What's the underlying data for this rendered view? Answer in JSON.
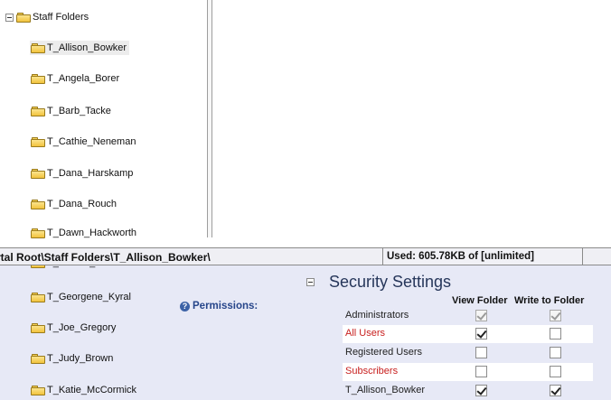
{
  "tree": {
    "root_label": "Staff Folders",
    "items": [
      {
        "label": "T_Allison_Bowker",
        "selected": true
      },
      {
        "label": "T_Angela_Borer"
      },
      {
        "label": "T_Barb_Tacke"
      },
      {
        "label": "T_Cathie_Neneman"
      },
      {
        "label": "T_Dana_Harskamp"
      },
      {
        "label": "T_Dana_Rouch"
      },
      {
        "label": "T_Dawn_Hackworth"
      },
      {
        "label": "T_Denise_Niemann"
      },
      {
        "label": "T_Georgene_Kyral"
      },
      {
        "label": "T_Joe_Gregory"
      },
      {
        "label": "T_Judy_Brown"
      },
      {
        "label": "T_Katie_McCormick"
      }
    ]
  },
  "pathbar": {
    "path": "rtal Root\\Staff Folders\\T_Allison_Bowker\\",
    "usage": "Used: 605.78KB of [unlimited]"
  },
  "permissions": {
    "label": "Permissions:",
    "help_icon": "help-icon"
  },
  "security": {
    "title": "Security Settings",
    "col_view": "View Folder",
    "col_write": "Write to Folder",
    "rows": [
      {
        "role": "Administrators",
        "red": false,
        "view": true,
        "write": true,
        "disabled": true
      },
      {
        "role": "All Users",
        "red": true,
        "view": true,
        "write": false,
        "disabled": false
      },
      {
        "role": "Registered Users",
        "red": false,
        "view": false,
        "write": false,
        "disabled": false
      },
      {
        "role": "Subscribers",
        "red": true,
        "view": false,
        "write": false,
        "disabled": false
      },
      {
        "role": "T_Allison_Bowker",
        "red": false,
        "view": true,
        "write": true,
        "disabled": false
      }
    ]
  },
  "colors": {
    "folder": "#f2c33c",
    "role_red": "#c8201f",
    "link_blue": "#26458a",
    "band": "#e7e9f6"
  }
}
